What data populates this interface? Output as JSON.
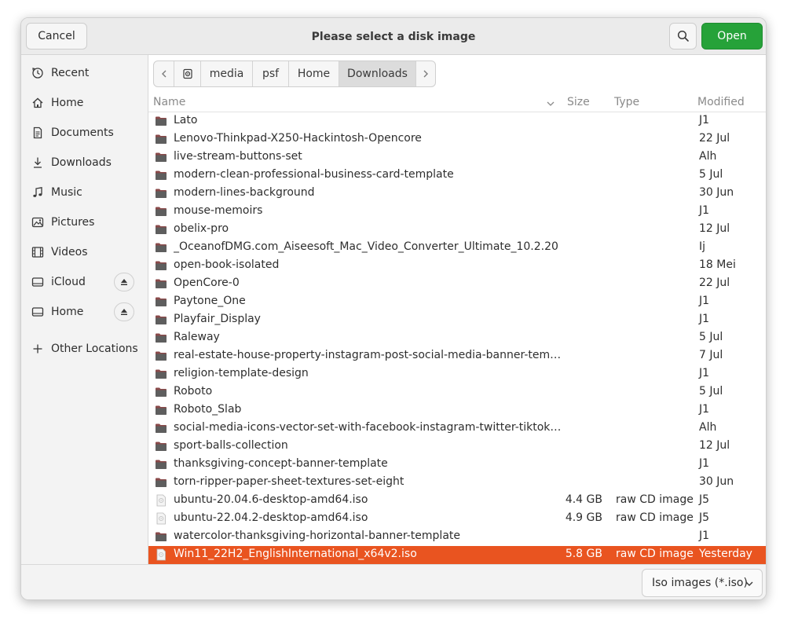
{
  "dialog": {
    "title": "Please select a disk image",
    "cancel_label": "Cancel",
    "open_label": "Open",
    "search_icon": "search-icon",
    "accent_color": "#26a239",
    "selection_color": "#e95420"
  },
  "sidebar": {
    "items": [
      {
        "label": "Recent",
        "icon": "clock-icon"
      },
      {
        "label": "Home",
        "icon": "home-icon"
      },
      {
        "label": "Documents",
        "icon": "document-icon"
      },
      {
        "label": "Downloads",
        "icon": "download-icon"
      },
      {
        "label": "Music",
        "icon": "music-icon"
      },
      {
        "label": "Pictures",
        "icon": "picture-icon"
      },
      {
        "label": "Videos",
        "icon": "video-icon"
      },
      {
        "label": "iCloud",
        "icon": "drive-icon",
        "eject": true
      },
      {
        "label": "Home",
        "icon": "drive-icon",
        "eject": true
      },
      {
        "label": "Other Locations",
        "icon": "plus-icon"
      }
    ]
  },
  "pathbar": {
    "crumbs": [
      "media",
      "psf",
      "Home",
      "Downloads"
    ],
    "active": "Downloads"
  },
  "columns": {
    "name": "Name",
    "size": "Size",
    "type": "Type",
    "modified": "Modified"
  },
  "files": [
    {
      "name": "Lato",
      "size": "",
      "type": "",
      "modified": "J1",
      "kind": "folder"
    },
    {
      "name": "Lenovo-Thinkpad-X250-Hackintosh-Opencore",
      "size": "",
      "type": "",
      "modified": "22 Jul",
      "kind": "folder"
    },
    {
      "name": "live-stream-buttons-set",
      "size": "",
      "type": "",
      "modified": "Alh",
      "kind": "folder"
    },
    {
      "name": "modern-clean-professional-business-card-template",
      "size": "",
      "type": "",
      "modified": "5 Jul",
      "kind": "folder"
    },
    {
      "name": "modern-lines-background",
      "size": "",
      "type": "",
      "modified": "30 Jun",
      "kind": "folder"
    },
    {
      "name": "mouse-memoirs",
      "size": "",
      "type": "",
      "modified": "J1",
      "kind": "folder"
    },
    {
      "name": "obelix-pro",
      "size": "",
      "type": "",
      "modified": "12 Jul",
      "kind": "folder"
    },
    {
      "name": "_OceanofDMG.com_Aiseesoft_Mac_Video_Converter_Ultimate_10.2.20",
      "size": "",
      "type": "",
      "modified": "Ij",
      "kind": "folder"
    },
    {
      "name": "open-book-isolated",
      "size": "",
      "type": "",
      "modified": "18 Mei",
      "kind": "folder"
    },
    {
      "name": "OpenCore-0",
      "size": "",
      "type": "",
      "modified": "22 Jul",
      "kind": "folder"
    },
    {
      "name": "Paytone_One",
      "size": "",
      "type": "",
      "modified": "J1",
      "kind": "folder"
    },
    {
      "name": "Playfair_Display",
      "size": "",
      "type": "",
      "modified": "J1",
      "kind": "folder"
    },
    {
      "name": "Raleway",
      "size": "",
      "type": "",
      "modified": "5 Jul",
      "kind": "folder"
    },
    {
      "name": "real-estate-house-property-instagram-post-social-media-banner-templ…",
      "size": "",
      "type": "",
      "modified": "7 Jul",
      "kind": "folder"
    },
    {
      "name": "religion-template-design",
      "size": "",
      "type": "",
      "modified": "J1",
      "kind": "folder"
    },
    {
      "name": "Roboto",
      "size": "",
      "type": "",
      "modified": "5 Jul",
      "kind": "folder"
    },
    {
      "name": "Roboto_Slab",
      "size": "",
      "type": "",
      "modified": "J1",
      "kind": "folder"
    },
    {
      "name": "social-media-icons-vector-set-with-facebook-instagram-twitter-tiktok-y…",
      "size": "",
      "type": "",
      "modified": "Alh",
      "kind": "folder"
    },
    {
      "name": "sport-balls-collection",
      "size": "",
      "type": "",
      "modified": "12 Jul",
      "kind": "folder"
    },
    {
      "name": "thanksgiving-concept-banner-template",
      "size": "",
      "type": "",
      "modified": "J1",
      "kind": "folder"
    },
    {
      "name": "torn-ripper-paper-sheet-textures-set-eight",
      "size": "",
      "type": "",
      "modified": "30 Jun",
      "kind": "folder"
    },
    {
      "name": "ubuntu-20.04.6-desktop-amd64.iso",
      "size": "4.4 GB",
      "type": "raw CD image",
      "modified": "J5",
      "kind": "iso"
    },
    {
      "name": "ubuntu-22.04.2-desktop-amd64.iso",
      "size": "4.9 GB",
      "type": "raw CD image",
      "modified": "J5",
      "kind": "iso"
    },
    {
      "name": "watercolor-thanksgiving-horizontal-banner-template",
      "size": "",
      "type": "",
      "modified": "J1",
      "kind": "folder"
    },
    {
      "name": "Win11_22H2_EnglishInternational_x64v2.iso",
      "size": "5.8 GB",
      "type": "raw CD image",
      "modified": "Yesterday",
      "kind": "iso",
      "selected": true
    }
  ],
  "footer": {
    "filter_label": "Iso images (*.iso)"
  }
}
